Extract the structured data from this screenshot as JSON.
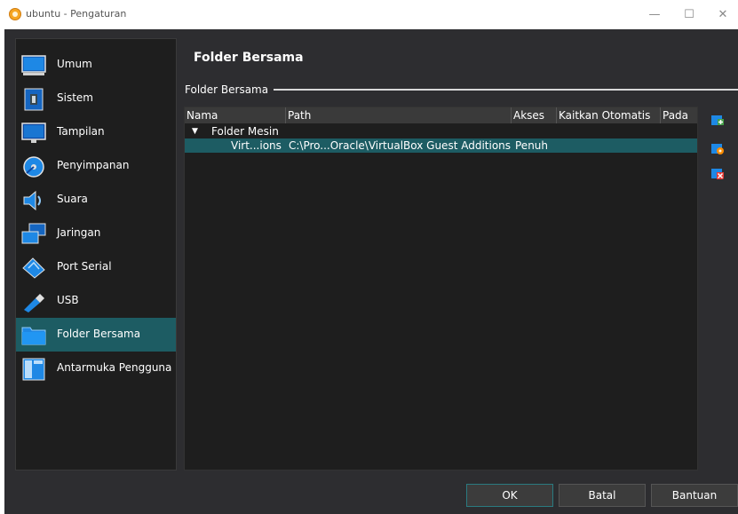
{
  "window": {
    "title": "ubuntu - Pengaturan",
    "controls": {
      "minimize": "—",
      "maximize": "☐",
      "close": "✕"
    }
  },
  "sidebar": {
    "items": [
      {
        "label": "Umum",
        "icon": "monitor-icon",
        "selected": false
      },
      {
        "label": "Sistem",
        "icon": "chip-icon",
        "selected": false
      },
      {
        "label": "Tampilan",
        "icon": "display-icon",
        "selected": false
      },
      {
        "label": "Penyimpanan",
        "icon": "disk-icon",
        "selected": false
      },
      {
        "label": "Suara",
        "icon": "speaker-icon",
        "selected": false
      },
      {
        "label": "Jaringan",
        "icon": "network-icon",
        "selected": false
      },
      {
        "label": "Port Serial",
        "icon": "serial-port-icon",
        "selected": false
      },
      {
        "label": "USB",
        "icon": "usb-icon",
        "selected": false
      },
      {
        "label": "Folder Bersama",
        "icon": "shared-folder-icon",
        "selected": true
      },
      {
        "label": "Antarmuka Pengguna",
        "icon": "user-interface-icon",
        "selected": false
      }
    ]
  },
  "page": {
    "title": "Folder Bersama",
    "group_label": "Folder Bersama"
  },
  "table": {
    "columns": [
      "Nama",
      "Path",
      "Akses",
      "Kaitkan Otomatis",
      "Pada"
    ],
    "group": {
      "label": "Folder Mesin",
      "expand_glyph": "▼"
    },
    "rows": [
      {
        "name": "Virt...ions",
        "path": "C:\\Pro...Oracle\\VirtualBox Guest Additions",
        "access": "Penuh",
        "auto_mount": "",
        "mount_point": ""
      }
    ]
  },
  "toolbar": {
    "buttons": [
      "add-shared-folder-icon",
      "edit-shared-folder-icon",
      "remove-shared-folder-icon"
    ]
  },
  "buttons": {
    "ok": "OK",
    "cancel": "Batal",
    "help": "Bantuan"
  },
  "colors": {
    "accent": "#1d5c63",
    "background": "#2d2d30",
    "panel": "#1e1e1e"
  }
}
